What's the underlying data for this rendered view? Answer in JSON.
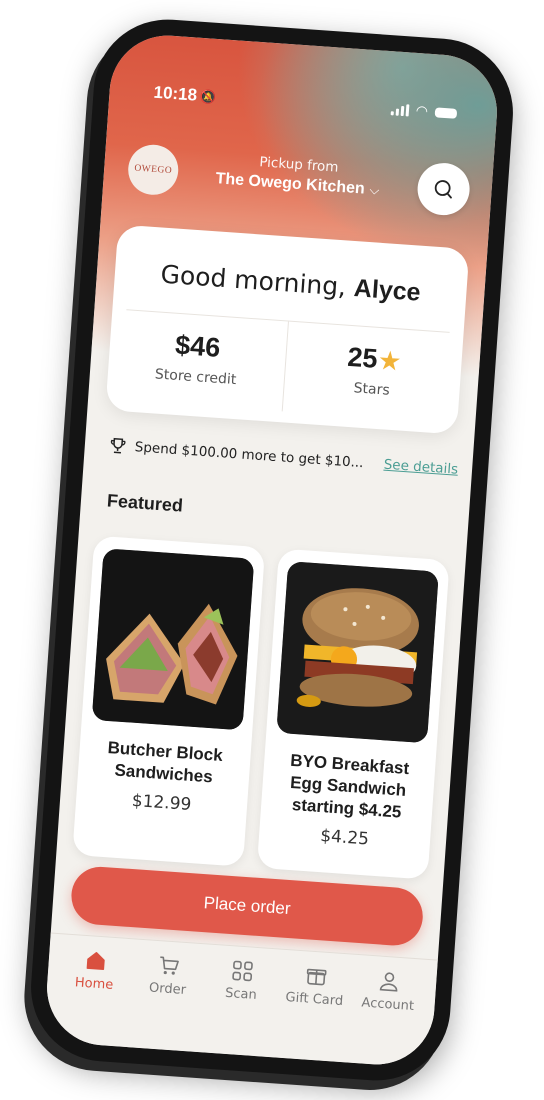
{
  "status": {
    "time": "10:18"
  },
  "header": {
    "logo_text": "OWEGO",
    "pickup_label": "Pickup from",
    "location": "The Owego Kitchen"
  },
  "greeting": {
    "prefix": "Good morning, ",
    "name": "Alyce"
  },
  "stats": {
    "credit_value": "$46",
    "credit_label": "Store credit",
    "stars_value": "25",
    "stars_label": "Stars"
  },
  "promo": {
    "text": "Spend $100.00 more to get $10...",
    "link": "See details"
  },
  "featured": {
    "heading": "Featured",
    "items": [
      {
        "name": "Butcher Block Sandwiches",
        "price": "$12.99"
      },
      {
        "name": "BYO Breakfast Egg Sandwich starting $4.25",
        "price": "$4.25"
      }
    ]
  },
  "cta": {
    "place_order": "Place order"
  },
  "carousel": {
    "active_index": 0,
    "dot_colors": [
      "#4c9e94",
      "#e0584a"
    ]
  },
  "tabs": [
    {
      "label": "Home",
      "icon": "home-icon",
      "active": true
    },
    {
      "label": "Order",
      "icon": "cart-icon",
      "active": false
    },
    {
      "label": "Scan",
      "icon": "qr-scan-icon",
      "active": false
    },
    {
      "label": "Gift Card",
      "icon": "gift-icon",
      "active": false
    },
    {
      "label": "Account",
      "icon": "person-icon",
      "active": false
    }
  ],
  "colors": {
    "brand": "#e0584a",
    "accent_teal": "#4c9e94",
    "star": "#f2b43a"
  }
}
